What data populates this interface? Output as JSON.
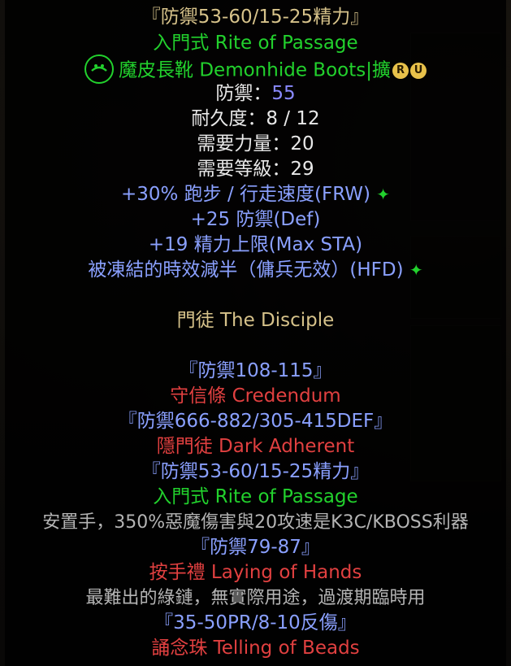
{
  "tooltip": {
    "l1": "『防禦53-60/15-25精力』",
    "l2": "入門式 Rite of Passage",
    "l3": "魔皮長靴 Demonhide Boots|擴",
    "badge_r": "R",
    "badge_u": "U",
    "l4_label": "防禦：",
    "l4_val": "55",
    "l5": "耐久度：8 / 12",
    "l6": "需要力量：20",
    "l7": "需要等級：29",
    "l8": "+30% 跑步 / 行走速度(FRW)",
    "l9": "+25 防禦(Def)",
    "l10": "+19 精力上限(Max STA)",
    "l11": "被凍結的時效減半（傭兵无效）(HFD)",
    "sparkle": "✦",
    "l12": "門徒 The Disciple",
    "l13": "『防禦108-115』",
    "l14": "守信條 Credendum",
    "l15": "『防禦666-882/305-415DEF』",
    "l16": "隱門徒 Dark Adherent",
    "l17": "『防禦53-60/15-25精力』",
    "l18": "入門式 Rite of Passage",
    "l19": "安置手，350%惡魔傷害與20攻速是K3C/KBOSS利器",
    "l20": "『防禦79-87』",
    "l21": "按手禮 Laying of Hands",
    "l22": "最難出的綠鏈，無實際用途，過渡期臨時用",
    "l23": "『35-50PR/8-10反傷』",
    "l24": "誦念珠 Telling of Beads"
  }
}
